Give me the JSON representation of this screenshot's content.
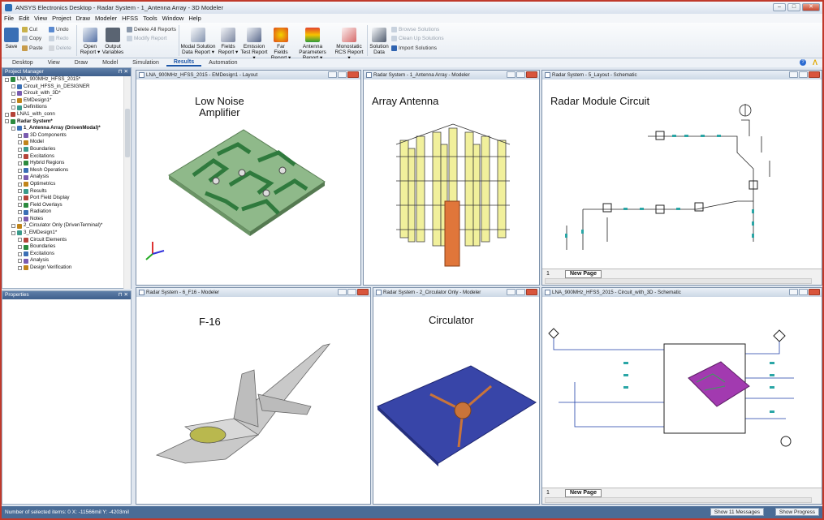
{
  "window": {
    "title": "ANSYS Electronics Desktop - Radar System - 1_Antenna Array - 3D Modeler"
  },
  "menu": [
    "File",
    "Edit",
    "View",
    "Project",
    "Draw",
    "Modeler",
    "HFSS",
    "Tools",
    "Window",
    "Help"
  ],
  "ribbon": {
    "save": "Save",
    "cut": "Cut",
    "copy": "Copy",
    "paste": "Paste",
    "undo": "Undo",
    "redo": "Redo",
    "delete": "Delete",
    "open_report": "Open Report ▾",
    "output_variables": "Output Variables",
    "delete_all_reports": "Delete All Reports",
    "modify_report": "Modify Report",
    "modal_solution": "Modal Solution Data Report ▾",
    "fields": "Fields Report ▾",
    "emission": "Emission Test Report ▾",
    "far_fields": "Far Fields Report ▾",
    "antenna": "Antenna Parameters Report ▾",
    "monostatic": "Monostatic RCS Report ▾",
    "solution_data": "Solution Data",
    "browse_solutions": "Browse Solutions",
    "clean_up_solutions": "Clean Up Solutions",
    "import_solutions": "Import Solutions"
  },
  "tabs": [
    "Desktop",
    "View",
    "Draw",
    "Model",
    "Simulation",
    "Results",
    "Automation"
  ],
  "active_tab": "Results",
  "project_manager": {
    "title": "Project Manager",
    "items": [
      {
        "label": "LNA_900MHz_HFSS_2015*",
        "level": 0,
        "bold": false
      },
      {
        "label": "Circuit_HFSS_in_DESIGNER",
        "level": 1,
        "bold": false
      },
      {
        "label": "Circuit_with_3D*",
        "level": 1,
        "bold": false
      },
      {
        "label": "EMDesign1*",
        "level": 1,
        "bold": false
      },
      {
        "label": "Definitions",
        "level": 1,
        "bold": false
      },
      {
        "label": "LNA1_with_conn",
        "level": 0,
        "bold": false
      },
      {
        "label": "Radar System*",
        "level": 0,
        "bold": true
      },
      {
        "label": "1_Antenna Array (DrivenModal)*",
        "level": 1,
        "bold": true
      },
      {
        "label": "3D Components",
        "level": 2,
        "bold": false
      },
      {
        "label": "Model",
        "level": 2,
        "bold": false
      },
      {
        "label": "Boundaries",
        "level": 2,
        "bold": false
      },
      {
        "label": "Excitations",
        "level": 2,
        "bold": false
      },
      {
        "label": "Hybrid Regions",
        "level": 2,
        "bold": false
      },
      {
        "label": "Mesh Operations",
        "level": 2,
        "bold": false
      },
      {
        "label": "Analysis",
        "level": 2,
        "bold": false
      },
      {
        "label": "Optimetrics",
        "level": 2,
        "bold": false
      },
      {
        "label": "Results",
        "level": 2,
        "bold": false
      },
      {
        "label": "Port Field Display",
        "level": 2,
        "bold": false
      },
      {
        "label": "Field Overlays",
        "level": 2,
        "bold": false
      },
      {
        "label": "Radiation",
        "level": 2,
        "bold": false
      },
      {
        "label": "Notes",
        "level": 2,
        "bold": false
      },
      {
        "label": "2_Circulator Only (DrivenTerminal)*",
        "level": 1,
        "bold": false
      },
      {
        "label": "3_EMDesign1*",
        "level": 1,
        "bold": false
      },
      {
        "label": "Circuit Elements",
        "level": 2,
        "bold": false
      },
      {
        "label": "Boundaries",
        "level": 2,
        "bold": false
      },
      {
        "label": "Excitations",
        "level": 2,
        "bold": false
      },
      {
        "label": "Analysis",
        "level": 2,
        "bold": false
      },
      {
        "label": "Design Verification",
        "level": 2,
        "bold": false
      }
    ]
  },
  "properties": {
    "title": "Properties"
  },
  "windows": {
    "w1": {
      "title": "LNA_900MHz_HFSS_2015 - EMDesign1 - Layout",
      "label": "Low Noise\nAmplifier"
    },
    "w2": {
      "title": "Radar System - 1_Antenna Array - Modeler",
      "label": "Array Antenna"
    },
    "w3": {
      "title": "Radar System - 5_Layout - Schematic",
      "label": "Radar Module Circuit",
      "page_num": "1",
      "page_tab": "New Page"
    },
    "w4": {
      "title": "Radar System - 6_F16 - Modeler",
      "label": "F-16"
    },
    "w5": {
      "title": "Radar System - 2_Circulator Only - Modeler",
      "label": "Circulator"
    },
    "w6": {
      "title": "LNA_900MHz_HFSS_2015 - Circuit_with_3D - Schematic",
      "page_num": "1",
      "page_tab": "New Page"
    }
  },
  "status": {
    "left": "Number of selected items: 0   X: -11566mil  Y: -4203mil",
    "messages": "Show 11 Messages",
    "progress": "Show Progress"
  }
}
